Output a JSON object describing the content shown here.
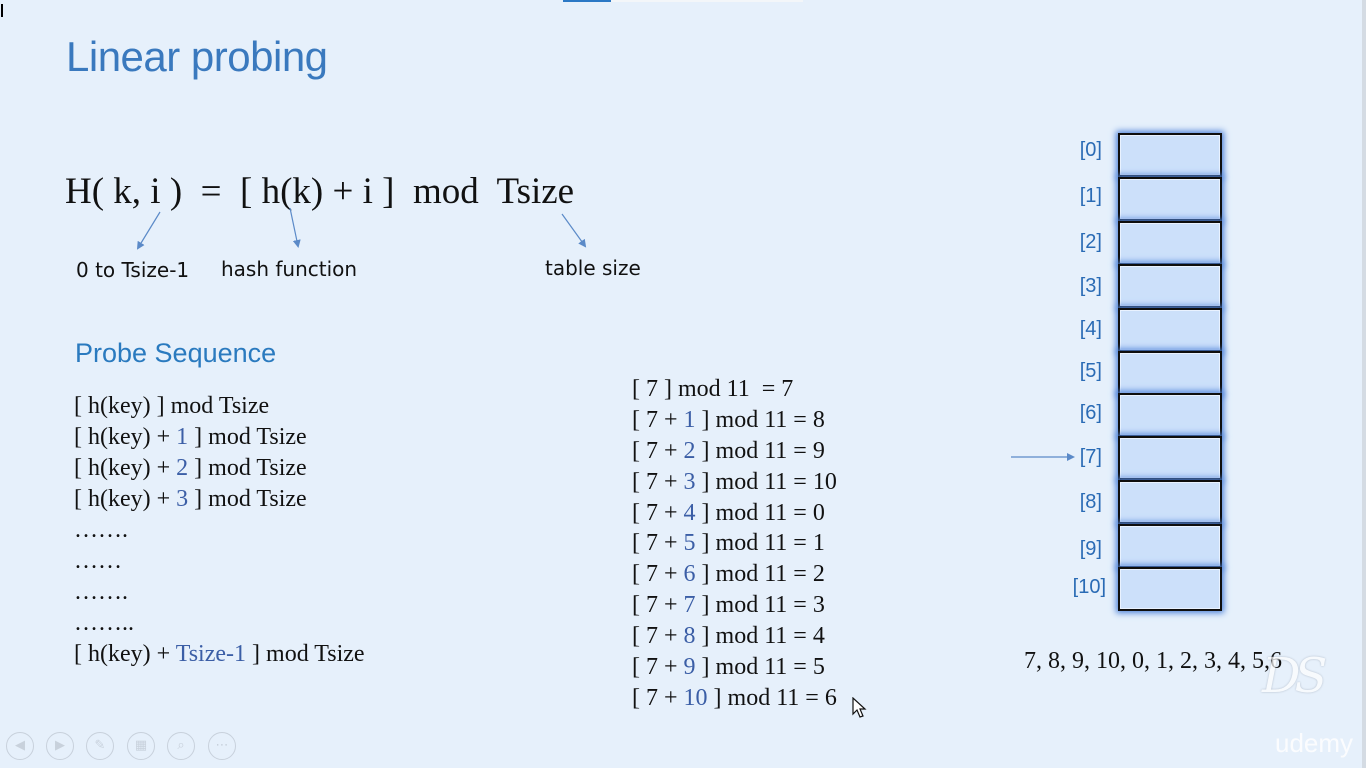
{
  "slide": {
    "title": "Linear probing",
    "formula": "H( k, i )  =  [ h(k) + i ]  mod  Tsize",
    "annotations": {
      "i_range": "0 to Tsize-1",
      "hash_function": "hash function",
      "table_size": "table size"
    },
    "probe_sequence": {
      "heading": "Probe Sequence",
      "lines": [
        {
          "pre": "[ h(key) ] mod Tsize",
          "num": "",
          "post": ""
        },
        {
          "pre": "[ h(key) + ",
          "num": "1",
          "post": " ] mod Tsize"
        },
        {
          "pre": "[ h(key) + ",
          "num": "2",
          "post": " ] mod Tsize"
        },
        {
          "pre": "[ h(key) + ",
          "num": "3",
          "post": " ] mod Tsize"
        },
        {
          "pre": "…….",
          "num": "",
          "post": ""
        },
        {
          "pre": "……",
          "num": "",
          "post": ""
        },
        {
          "pre": "…….",
          "num": "",
          "post": ""
        },
        {
          "pre": "……..",
          "num": "",
          "post": ""
        },
        {
          "pre": "[ h(key) + ",
          "num": "Tsize-1",
          "post": " ] mod Tsize"
        }
      ]
    },
    "calculations": [
      {
        "pre": "[ 7 ] mod 11  = 7",
        "num": "",
        "post": ""
      },
      {
        "pre": "[ 7 + ",
        "num": "1",
        "post": " ] mod 11 = 8"
      },
      {
        "pre": "[ 7 + ",
        "num": "2",
        "post": " ] mod 11 = 9"
      },
      {
        "pre": "[ 7 + ",
        "num": "3",
        "post": " ] mod 11 = 10"
      },
      {
        "pre": "[ 7 + ",
        "num": "4",
        "post": " ] mod 11 = 0"
      },
      {
        "pre": "[ 7 + ",
        "num": "5",
        "post": " ] mod 11 = 1"
      },
      {
        "pre": "[ 7 + ",
        "num": "6",
        "post": " ] mod 11 = 2"
      },
      {
        "pre": "[ 7 + ",
        "num": "7",
        "post": " ] mod 11 = 3"
      },
      {
        "pre": "[ 7 + ",
        "num": "8",
        "post": " ] mod 11 = 4"
      },
      {
        "pre": "[ 7 + ",
        "num": "9",
        "post": " ] mod 11 = 5"
      },
      {
        "pre": "[ 7 + ",
        "num": "10",
        "post": " ] mod 11 = 6"
      }
    ],
    "table": {
      "indices": [
        "[0]",
        "[1]",
        "[2]",
        "[3]",
        "[4]",
        "[5]",
        "[6]",
        "[7]",
        "[8]",
        "[9]",
        "[10]"
      ],
      "pointer_index": 7
    },
    "result_sequence": "7, 8, 9, 10, 0, 1, 2, 3, 4, 5,6",
    "logo_text": "DS",
    "watermark": "udemy"
  },
  "player_controls": [
    {
      "icon": "previous-icon",
      "glyph": "◀"
    },
    {
      "icon": "next-icon",
      "glyph": "▶"
    },
    {
      "icon": "pen-icon",
      "glyph": "✎"
    },
    {
      "icon": "slides-grid-icon",
      "glyph": "▦"
    },
    {
      "icon": "zoom-icon",
      "glyph": "⌕"
    },
    {
      "icon": "more-options-icon",
      "glyph": "⋯"
    }
  ],
  "colors": {
    "background": "#e6f0fb",
    "title": "#3a79be",
    "heading": "#2a7abf",
    "number_highlight": "#3b5ea6",
    "table_cell": "#cce0fa",
    "index_label": "#2a6bb5"
  }
}
